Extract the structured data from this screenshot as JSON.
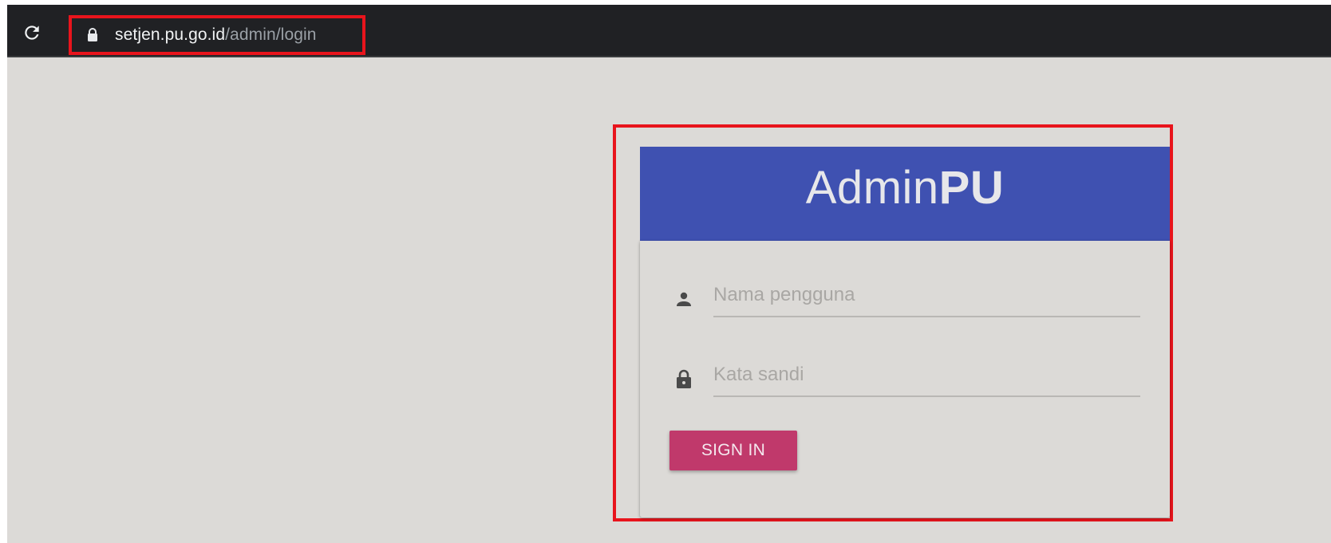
{
  "browser": {
    "url_host": "setjen.pu.go.id",
    "url_path": "/admin/login",
    "reload_icon": "reload-icon",
    "secure_icon": "lock-icon"
  },
  "login": {
    "brand_regular": "Admin",
    "brand_bold": "PU",
    "username_placeholder": "Nama pengguna",
    "password_placeholder": "Kata sandi",
    "username_icon": "person-icon",
    "password_icon": "lock-icon",
    "signin_label": "SIGN IN"
  },
  "colors": {
    "page_background": "#dcdad7",
    "header_background": "#3f51b1",
    "button_background": "#c0396b",
    "highlight_border": "#e8141c",
    "toolbar_background": "#202124"
  }
}
